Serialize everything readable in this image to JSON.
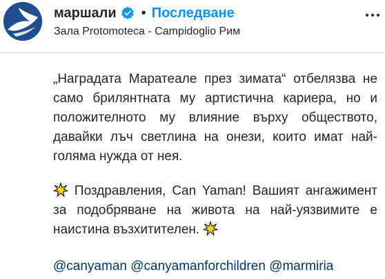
{
  "post": {
    "username": "маршали",
    "separator": "•",
    "follow_label": "Последване",
    "location": "Зала Protomoteca - Campidoglio Рим",
    "icons": {
      "avatar": "bird-logo-avatar",
      "verified": "verified-badge-icon",
      "more": "more-options-icon",
      "sparkle": "sparkle-star-icon"
    },
    "caption": {
      "paragraph_1": "„Наградата Маратеале през зимата“ отбелязва не само брилянтната му артистична кариера, но и положителното му влияние върху обществото, давайки лъч светлина на онези, които имат най-голяма нужда от нея.",
      "paragraph_2_text": " Поздравления, Can Yaman! Вашият ангажимент за подобряване на живота на най-уязвимите е наистина възхитителен. "
    },
    "mentions": [
      "@canyaman",
      "@canyamanforchildren",
      "@marmiria"
    ],
    "colors": {
      "link_blue": "#0095f6",
      "mention": "#00376b",
      "verified_blue": "#0095f6",
      "avatar_bg": "#214e8e",
      "star_fill": "#fcd116"
    }
  }
}
